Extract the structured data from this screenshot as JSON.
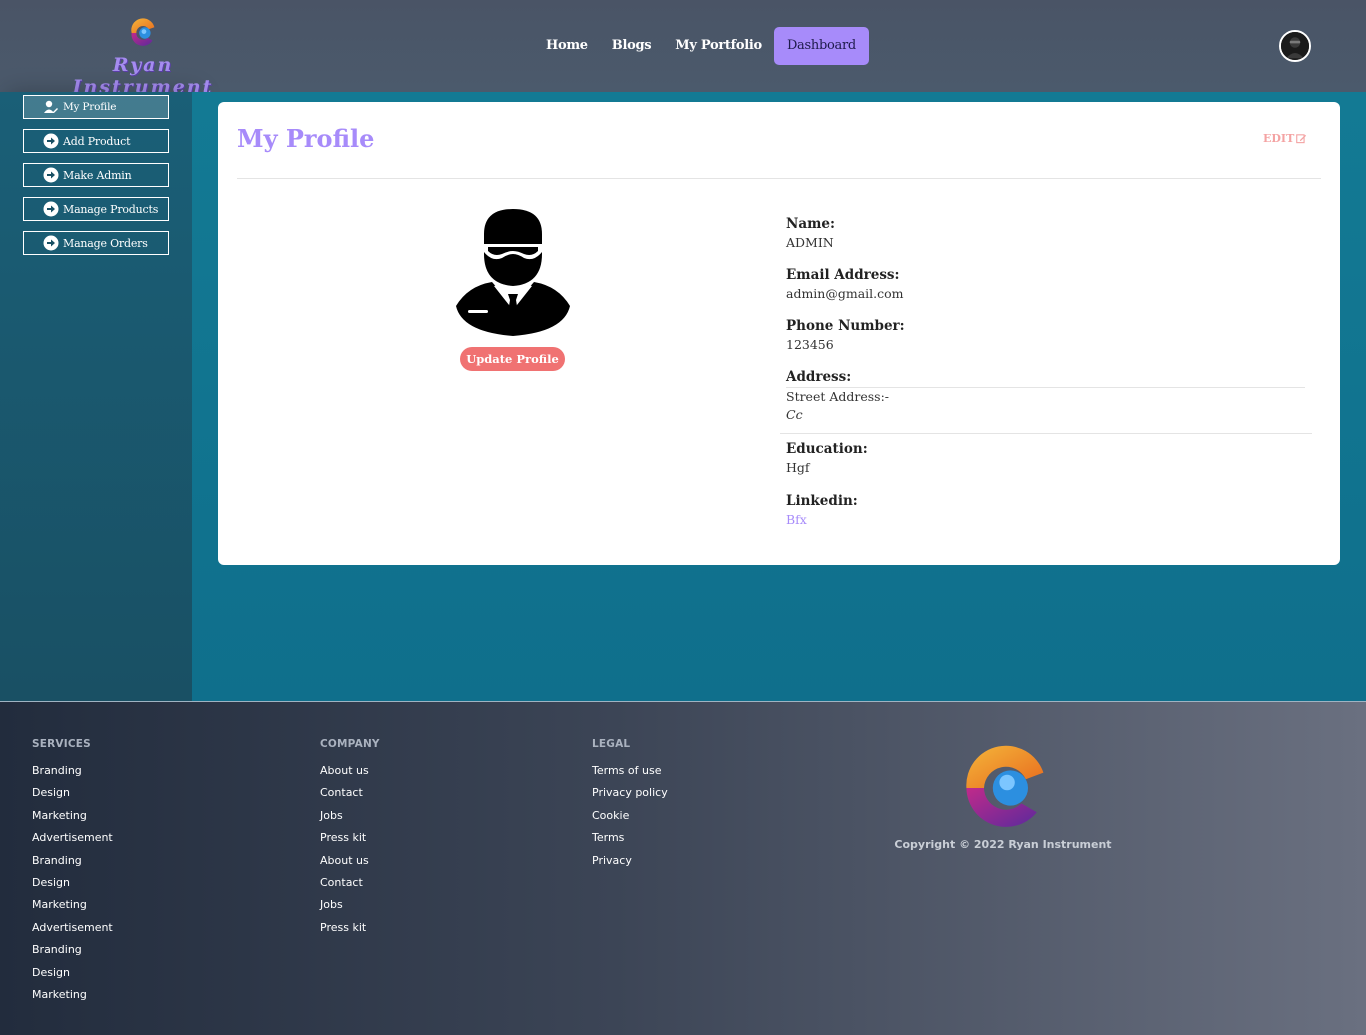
{
  "brand": {
    "name": "Ryan Instrument"
  },
  "nav": {
    "items": [
      {
        "label": "Home",
        "active": false
      },
      {
        "label": "Blogs",
        "active": false
      },
      {
        "label": "My Portfolio",
        "active": false
      },
      {
        "label": "Dashboard",
        "active": true
      }
    ]
  },
  "sidebar": {
    "items": [
      {
        "label": "My Profile",
        "icon": "user-edit-icon"
      },
      {
        "label": "Add Product",
        "icon": "arrow-circle-right-icon"
      },
      {
        "label": "Make Admin",
        "icon": "arrow-circle-right-icon"
      },
      {
        "label": "Manage Products",
        "icon": "arrow-circle-right-icon"
      },
      {
        "label": "Manage Orders",
        "icon": "arrow-circle-right-icon"
      }
    ]
  },
  "profile": {
    "title": "My Profile",
    "edit_label": "EDIT",
    "update_button": "Update Profile",
    "fields": {
      "name": {
        "label": "Name:",
        "value": "ADMIN"
      },
      "email": {
        "label": "Email Address:",
        "value": "admin@gmail.com"
      },
      "phone": {
        "label": "Phone Number:",
        "value": "123456"
      },
      "address": {
        "label": "Address:",
        "street_label": "Street Address:-",
        "value": "Cc"
      },
      "education": {
        "label": "Education:",
        "value": "Hgf"
      },
      "linkedin": {
        "label": "Linkedin:",
        "value": "Bfx"
      }
    }
  },
  "footer": {
    "services": {
      "heading": "SERVICES",
      "items": [
        "Branding",
        "Design",
        "Marketing",
        "Advertisement",
        "Branding",
        "Design",
        "Marketing",
        "Advertisement",
        "Branding",
        "Design",
        "Marketing"
      ]
    },
    "company": {
      "heading": "COMPANY",
      "items": [
        "About us",
        "Contact",
        "Jobs",
        "Press kit",
        "About us",
        "Contact",
        "Jobs",
        "Press kit"
      ]
    },
    "legal": {
      "heading": "LEGAL",
      "items": [
        "Terms of use",
        "Privacy policy",
        "Cookie",
        "Terms",
        "Privacy"
      ]
    },
    "copyright": "Copyright © 2022 Ryan Instrument"
  },
  "colors": {
    "accent": "#a78bfa",
    "update_button": "#f07272",
    "edit_link": "#f4a3a3",
    "main_bg": "#0f6f8c"
  }
}
